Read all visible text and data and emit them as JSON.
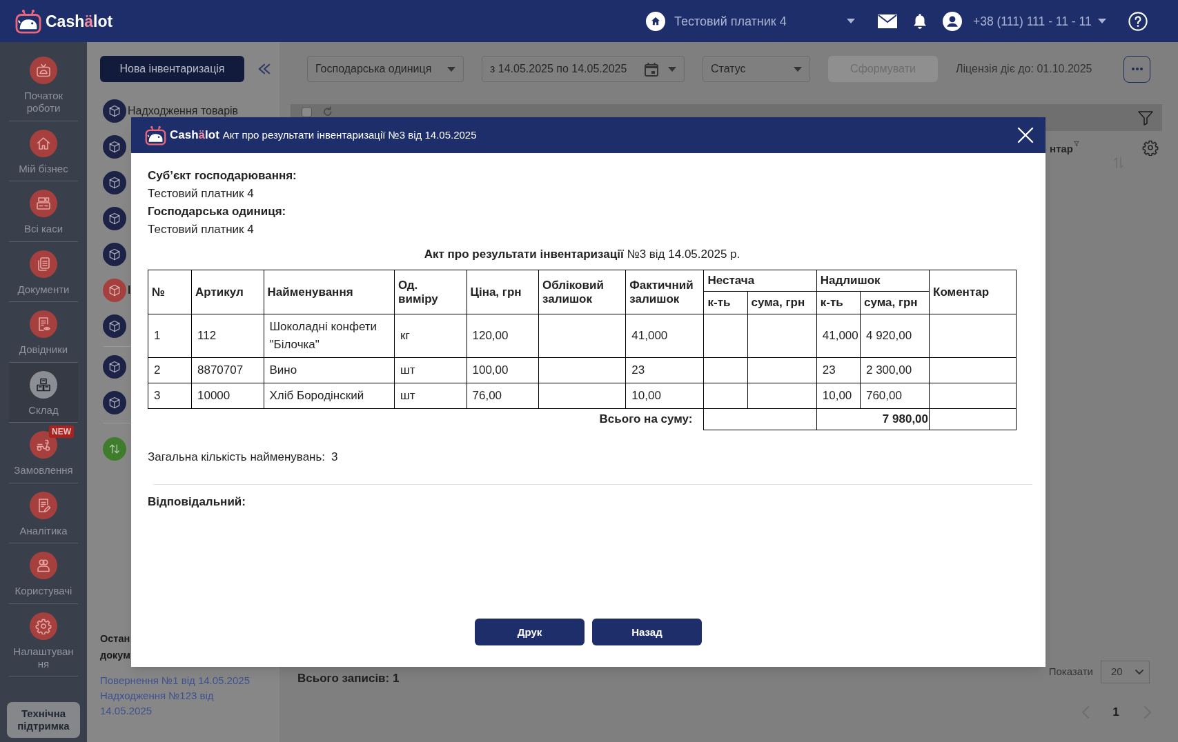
{
  "top_bar": {
    "logo": [
      {
        "text": "Cash",
        "accent": false
      },
      {
        "text": "ä",
        "accent": true
      },
      {
        "text": "lot",
        "accent": false
      }
    ],
    "company": "Тестовий платник 4",
    "phone": "+38 (111) 111 - 11 - 11"
  },
  "sidebar": {
    "items": [
      {
        "label": "Початок роботи",
        "selected": false
      },
      {
        "label": "Мій бізнес",
        "selected": false
      },
      {
        "label": "Всі каси",
        "selected": false
      },
      {
        "label": "Документи",
        "selected": false
      },
      {
        "label": "Довідники",
        "selected": false
      },
      {
        "label": "Склад",
        "selected": true
      },
      {
        "label": "Замовлення",
        "selected": false,
        "badge": "NEW"
      },
      {
        "label": "Аналітика",
        "selected": false
      },
      {
        "label": "Користувачі",
        "selected": false
      },
      {
        "label": "Налаштування",
        "selected": false
      }
    ],
    "support_button": "Технічна підтримка"
  },
  "section_panel": {
    "new_button": "Нова інвентаризація",
    "nav_groups": [
      {
        "items": [
          {
            "label": "Надходження товарів",
            "selected": false,
            "color": "#1c2347"
          },
          {
            "selected": false,
            "color": "#1c2347"
          },
          {
            "selected": false,
            "color": "#1c2347"
          },
          {
            "selected": false,
            "color": "#1c2347"
          },
          {
            "selected": false,
            "color": "#1c2347"
          },
          {
            "label": "І",
            "selected": true,
            "color": "#a5403e"
          },
          {
            "selected": false,
            "color": "#1c2347"
          }
        ]
      },
      {
        "items": [
          {
            "selected": false,
            "color": "#1c2347"
          },
          {
            "selected": false,
            "color": "#1c2347"
          }
        ]
      },
      {
        "items": [
          {
            "selected": false,
            "color": "#3f7d2d"
          }
        ]
      }
    ],
    "recent_title_lines": [
      "Остан",
      "докум"
    ],
    "recent_links": [
      "Повернення №1 від 14.05.2025",
      "Надходження №123 від 14.05.2025"
    ]
  },
  "toolbar": {
    "filters": [
      {
        "kind": "select",
        "text": "Господарська одиниця"
      },
      {
        "kind": "date",
        "text": "з 14.05.2025 по 14.05.2025"
      },
      {
        "kind": "select",
        "text": "Статус"
      }
    ],
    "generate_button": {
      "label": "Сформувати",
      "disabled": true
    },
    "license": "Ліцензія діє до: 01.10.2025"
  },
  "grid": {
    "select_all": {
      "checked": false
    },
    "column_partial": "нтар",
    "total_records": "Всього записів: 1",
    "page_size_label": "Показати",
    "page_size": "20",
    "pages": [
      {
        "label": "1",
        "selected": true
      }
    ]
  },
  "modal": {
    "logo": [
      {
        "text": "Cash",
        "accent": false
      },
      {
        "text": "ä",
        "accent": true
      },
      {
        "text": "lot",
        "accent": false
      }
    ],
    "title": "Акт про результати інвентаризації №3 від 14.05.2025",
    "fields": [
      {
        "label": "Суб’єкт господарювання:",
        "value": "Тестовий платник 4"
      },
      {
        "label": "Господарська одиниця:",
        "value": "Тестовий платник 4"
      }
    ],
    "heading": "**Акт про результати інвентаризації** №3 від 14.05.2025 р.",
    "table": {
      "columns": [
        {
          "label": "№"
        },
        {
          "label": "Артикул"
        },
        {
          "label": "Найменування"
        },
        {
          "label": "Од. виміру"
        },
        {
          "label": "Ціна, грн"
        },
        {
          "label": "Обліковий залишок"
        },
        {
          "label": "Фактичний залишок"
        },
        {
          "label": "Нестача",
          "subcolumns": [
            {
              "label": "к-ть"
            },
            {
              "label": "сума, грн"
            }
          ]
        },
        {
          "label": "Надлишок",
          "subcolumns": [
            {
              "label": "к-ть"
            },
            {
              "label": "сума, грн"
            }
          ]
        },
        {
          "label": "Коментар"
        }
      ],
      "rows": [
        {
          "no": "1",
          "article": "112",
          "name": "Шоколадні конфети \"Білочка\"",
          "unit": "кг",
          "price": "120,00",
          "actual_balance": "41,000",
          "surplus_qty": "41,000",
          "surplus_sum": "4 920,00"
        },
        {
          "no": "2",
          "article": "8870707",
          "name": "Вино",
          "unit": "шт",
          "price": "100,00",
          "actual_balance": "23",
          "surplus_qty": "23",
          "surplus_sum": "2 300,00"
        },
        {
          "no": "3",
          "article": "10000",
          "name": "Хліб Бородінский",
          "unit": "шт",
          "price": "76,00",
          "actual_balance": "10,00",
          "surplus_qty": "10,00",
          "surplus_sum": "760,00"
        }
      ],
      "total": {
        "label": "Всього на суму:",
        "surplus_sum": "7 980,00"
      }
    },
    "count": {
      "label": "Загальна кількість найменувань:",
      "value": "3"
    },
    "responsible_label": "Відповідальний:",
    "buttons": [
      "Друк",
      "Назад"
    ]
  }
}
